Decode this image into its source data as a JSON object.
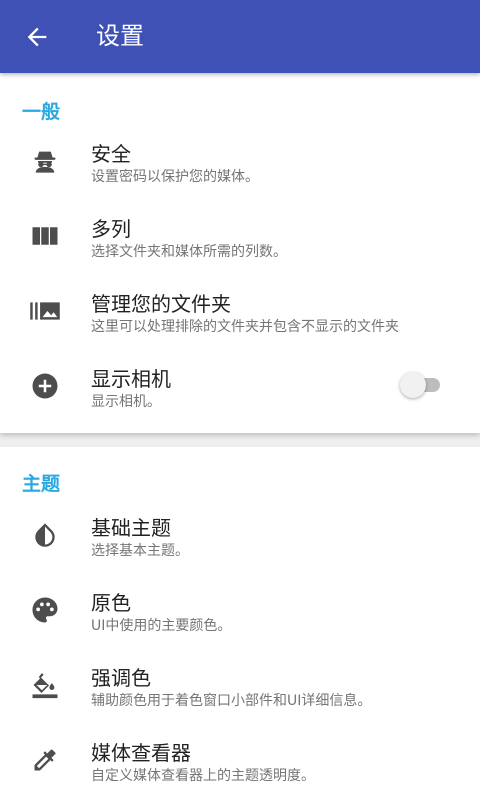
{
  "appbar": {
    "title": "设置"
  },
  "general": {
    "header": "一般",
    "items": [
      {
        "title": "安全",
        "subtitle": "设置密码以保护您的媒体。",
        "icon": "incognito-icon"
      },
      {
        "title": "多列",
        "subtitle": "选择文件夹和媒体所需的列数。",
        "icon": "view-column-icon"
      },
      {
        "title": "管理您的文件夹",
        "subtitle": "这里可以处理排除的文件夹并包含不显示的文件夹",
        "icon": "folder-list-icon"
      },
      {
        "title": "显示相机",
        "subtitle": "显示相机。",
        "icon": "add-circle-icon",
        "toggle": false
      }
    ]
  },
  "theme": {
    "header": "主题",
    "items": [
      {
        "title": "基础主题",
        "subtitle": "选择基本主题。",
        "icon": "invert-colors-icon"
      },
      {
        "title": "原色",
        "subtitle": "UI中使用的主要颜色。",
        "icon": "palette-icon"
      },
      {
        "title": "强调色",
        "subtitle": "辅助颜色用于着色窗口小部件和UI详细信息。",
        "icon": "paint-bucket-icon"
      },
      {
        "title": "媒体查看器",
        "subtitle": "自定义媒体查看器上的主题透明度。",
        "icon": "eyedropper-icon"
      }
    ]
  },
  "colors": {
    "primary": "#3f51b5",
    "section_header": "#2aa8e0",
    "icon": "#4d4d4d"
  }
}
